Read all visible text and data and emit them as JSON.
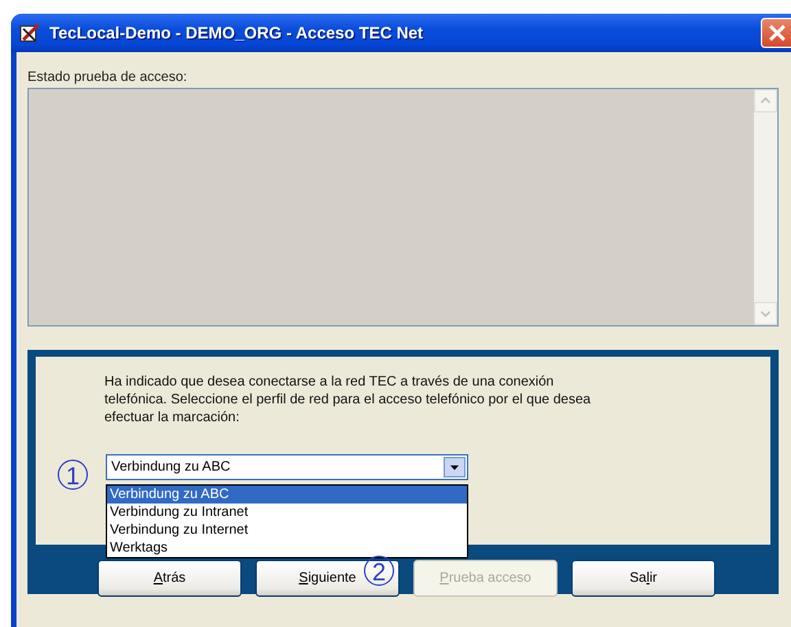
{
  "window": {
    "title": "TecLocal-Demo - DEMO_ORG - Acceso TEC Net"
  },
  "status_label": "Estado prueba de acceso:",
  "status_box": {
    "disabled": true
  },
  "instructions": "Ha indicado que desea conectarse a la red TEC a través de una conexión telefónica. Seleccione el perfil de red para el acceso telefónico por el que desea efectuar la marcación:",
  "profile_combo": {
    "value": "Verbindung zu ABC",
    "expanded": true,
    "options": [
      {
        "label": "Verbindung zu ABC",
        "selected": true
      },
      {
        "label": "Verbindung zu Intranet",
        "selected": false
      },
      {
        "label": "Verbindung zu Internet",
        "selected": false
      },
      {
        "label": "Werktags",
        "selected": false
      }
    ]
  },
  "buttons": [
    {
      "key": "A",
      "post": "trás",
      "disabled": false
    },
    {
      "key": "S",
      "post": "iguiente",
      "disabled": false
    },
    {
      "key": "P",
      "post": "rueba acceso",
      "disabled": true
    },
    {
      "pre": "Sa",
      "key": "l",
      "post": "ir",
      "disabled": false
    }
  ],
  "callouts": [
    {
      "number": "1"
    },
    {
      "number": "2"
    }
  ]
}
